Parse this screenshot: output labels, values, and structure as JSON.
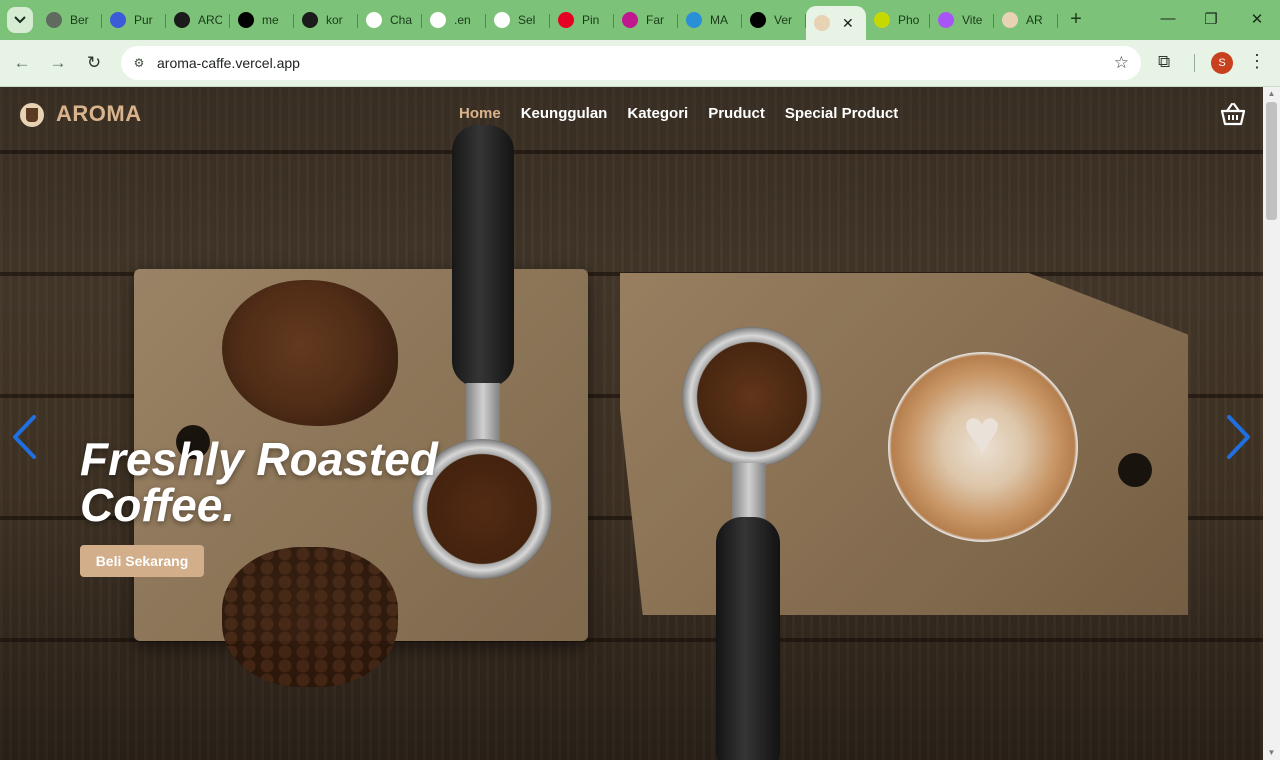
{
  "browser": {
    "tabs": [
      {
        "label": "Ber",
        "icon": "globe-icon",
        "color": "#5f6b5f"
      },
      {
        "label": "Pur",
        "icon": "printer-icon",
        "color": "#3b5bd9"
      },
      {
        "label": "ARC",
        "icon": "bolt-icon",
        "color": "#1b1b1b"
      },
      {
        "label": "me",
        "icon": "triangle-icon",
        "color": "#000000"
      },
      {
        "label": "kor",
        "icon": "github-icon",
        "color": "#1b1b1b"
      },
      {
        "label": "Cha",
        "icon": "openai-icon",
        "color": "#ffffff"
      },
      {
        "label": ".en",
        "icon": "gmail-icon",
        "color": "#ffffff"
      },
      {
        "label": "Sel",
        "icon": "apps-icon",
        "color": "#ffffff"
      },
      {
        "label": "Pin",
        "icon": "pinterest-icon",
        "color": "#e60023"
      },
      {
        "label": "Far",
        "icon": "circle-icon",
        "color": "#c2188f"
      },
      {
        "label": "MA",
        "icon": "bars-icon",
        "color": "#2b8fd6"
      },
      {
        "label": "Ver",
        "icon": "triangle-icon",
        "color": "#000000"
      },
      {
        "label": "",
        "icon": "aroma-favicon-icon",
        "color": "#e7d2b4",
        "active": true
      },
      {
        "label": "Pho",
        "icon": "p-icon",
        "color": "#c5d800"
      },
      {
        "label": "Vite",
        "icon": "vite-icon",
        "color": "#a855f7"
      },
      {
        "label": "AR",
        "icon": "aroma-favicon-icon",
        "color": "#e7d2b4"
      }
    ],
    "url": "aroma-caffe.vercel.app",
    "profile_initial": "S"
  },
  "site": {
    "brand": "AROMA",
    "nav": [
      "Home",
      "Keunggulan",
      "Kategori",
      "Pruduct",
      "Special Product"
    ],
    "active_nav": "Home",
    "hero_title": "Freshly Roasted Coffee.",
    "cta": "Beli Sekarang",
    "accent_color": "#d2ae8a",
    "arrow_color": "#1f6fe0"
  }
}
